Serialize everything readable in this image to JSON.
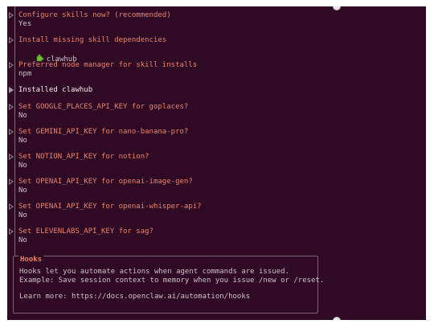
{
  "prompts": [
    {
      "question": "Configure skills now? (recommended)",
      "answer": "Yes"
    },
    {
      "question": "Install missing skill dependencies",
      "answer": "clawhub",
      "answer_icon": "puzzle-piece-icon"
    },
    {
      "question": "Preferred node manager for skill installs",
      "answer": "npm"
    }
  ],
  "installed_message": "Installed clawhub",
  "api_prompts": [
    {
      "question": "Set GOOGLE_PLACES_API_KEY for goplaces?",
      "answer": "No"
    },
    {
      "question": "Set GEMINI_API_KEY for nano-banana-pro?",
      "answer": "No"
    },
    {
      "question": "Set NOTION_API_KEY for notion?",
      "answer": "No"
    },
    {
      "question": "Set OPENAI_API_KEY for openai-image-gen?",
      "answer": "No"
    },
    {
      "question": "Set OPENAI_API_KEY for openai-whisper-api?",
      "answer": "No"
    },
    {
      "question": "Set ELEVENLABS_API_KEY for sag?",
      "answer": "No"
    }
  ],
  "hooks": {
    "title": "Hooks",
    "line1": "Hooks let you automate actions when agent commands are issued.",
    "line2": "Example: Save session context to memory when you issue /new or /reset.",
    "line3": "Learn more: https://docs.openclaw.ai/automation/hooks"
  },
  "colors": {
    "background": "#300a24",
    "prompt": "#e6836d",
    "answer": "#cbbfc7"
  }
}
